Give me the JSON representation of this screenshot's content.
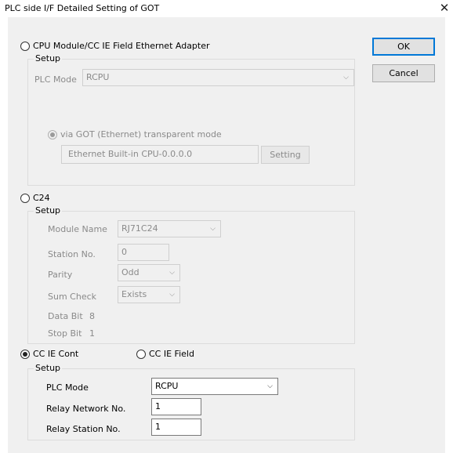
{
  "window": {
    "title": "PLC side I/F Detailed Setting of GOT",
    "close_glyph": "✕"
  },
  "buttons": {
    "ok": "OK",
    "cancel": "Cancel"
  },
  "cpu": {
    "radio_label": "CPU Module/CC IE Field Ethernet Adapter",
    "setup_legend": "Setup",
    "plc_mode_label": "PLC Mode",
    "plc_mode_value": "RCPU",
    "via_label": "via GOT (Ethernet) transparent mode",
    "target_value": "Ethernet Built-in CPU-0.0.0.0",
    "setting_button": "Setting"
  },
  "c24": {
    "radio_label": "C24",
    "setup_legend": "Setup",
    "module_name_label": "Module Name",
    "module_name_value": "RJ71C24",
    "station_label": "Station No.",
    "station_value": "0",
    "parity_label": "Parity",
    "parity_value": "Odd",
    "sum_check_label": "Sum Check",
    "sum_check_value": "Exists",
    "data_bit_label": "Data Bit",
    "data_bit_value": "8",
    "stop_bit_label": "Stop Bit",
    "stop_bit_value": "1"
  },
  "ccie": {
    "cont_label": "CC IE Cont",
    "field_label": "CC IE Field",
    "setup_legend": "Setup",
    "plc_mode_label": "PLC Mode",
    "plc_mode_value": "RCPU",
    "relay_network_label": "Relay Network No.",
    "relay_network_value": "1",
    "relay_station_label": "Relay Station No.",
    "relay_station_value": "1"
  },
  "selection": {
    "interface": "CC IE Cont",
    "via_transparent_mode": true
  },
  "icons": {
    "chevron": "chevron-down-icon",
    "close": "close-icon"
  },
  "colors": {
    "default_button_border": "#0078d7",
    "dialog_bg": "#f0f0f0"
  }
}
